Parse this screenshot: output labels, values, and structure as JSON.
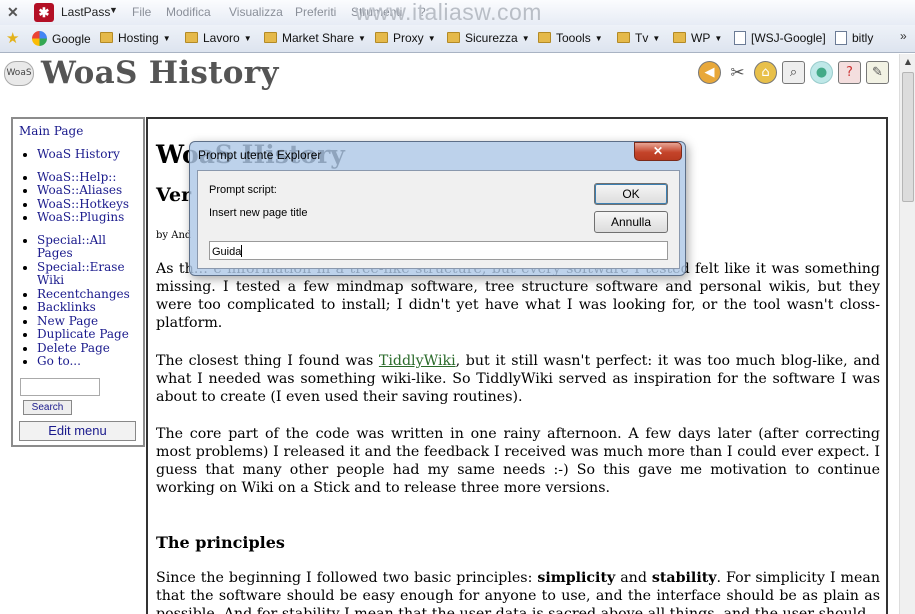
{
  "browser": {
    "menu": {
      "close_glyph": "✕",
      "lastpass_label": "LastPass",
      "items": [
        "File",
        "Modifica",
        "Visualizza",
        "Preferiti",
        "Strumenti",
        "?"
      ]
    },
    "watermark": "www.italiasw.com",
    "bookmarks": [
      {
        "label": "Google",
        "icon": "google-icon"
      },
      {
        "label": "Hosting",
        "icon": "folder-icon",
        "dropdown": true
      },
      {
        "label": "Lavoro",
        "icon": "folder-icon",
        "dropdown": true
      },
      {
        "label": "Market Share",
        "icon": "folder-icon",
        "dropdown": true
      },
      {
        "label": "Proxy",
        "icon": "folder-icon",
        "dropdown": true
      },
      {
        "label": "Sicurezza",
        "icon": "folder-icon",
        "dropdown": true
      },
      {
        "label": "Toools",
        "icon": "folder-icon",
        "dropdown": true
      },
      {
        "label": "Tv",
        "icon": "folder-icon",
        "dropdown": true
      },
      {
        "label": "WP",
        "icon": "folder-icon",
        "dropdown": true
      },
      {
        "label": "[WSJ-Google]",
        "icon": "page-icon"
      },
      {
        "label": "bitly",
        "icon": "page-icon"
      }
    ]
  },
  "header": {
    "logo_text": "WoaS",
    "title": "WoaS History"
  },
  "sidebar": {
    "main_page": "Main Page",
    "group1": [
      "WoaS History"
    ],
    "group2": [
      "WoaS::Help::",
      "WoaS::Aliases",
      "WoaS::Hotkeys",
      "WoaS::Plugins"
    ],
    "group3": [
      "Special::All Pages",
      "Special::Erase Wiki",
      "Recentchanges",
      "Backlinks",
      "New Page",
      "Duplicate Page",
      "Delete Page",
      "Go to..."
    ],
    "search_button": "Search",
    "edit_menu": "Edit menu"
  },
  "content": {
    "title": "WoaS History",
    "heading": "Ver",
    "byline": "by And",
    "p1": "As th… e information in a tree-like structure, but every software I tested felt like it was something missing. I tested a few mindmap software, tree structure software and personal wikis, but they were too complicated to install; I didn't yet have what I was looking for, or the tool wasn't closs-platform.",
    "p2_before": "The closest thing I found was ",
    "p2_link": "TiddlyWiki",
    "p2_after": ", but it still wasn't perfect: it was too much blog-like, and what I needed was something wiki-like. So TiddlyWiki served as inspiration for the software I was about to create (I even used their saving routines).",
    "p3": "The core part of the code was written in one rainy afternoon. A few days later (after correcting most problems) I released it and the feedback I received was much more than I could ever expect. I guess that many other people had my same needs :-) So this gave me motivation to continue working on Wiki on a Stick and to release three more versions.",
    "principles_heading": "The principles",
    "p4_a": "Since the beginning I followed two basic principles: ",
    "p4_b1": "simplicity",
    "p4_and": " and ",
    "p4_b2": "stability",
    "p4_c": ". For simplicity I mean that the software should be easy enough for anyone to use, and the interface should be as plain as possible. And for stability I mean that the user data is sacred above all things, and the user should"
  },
  "dialog": {
    "title": "Prompt utente Explorer",
    "close_glyph": "✕",
    "label": "Prompt script:",
    "message": "Insert new page title",
    "ok": "OK",
    "cancel": "Annulla",
    "input_value": "Guida"
  }
}
